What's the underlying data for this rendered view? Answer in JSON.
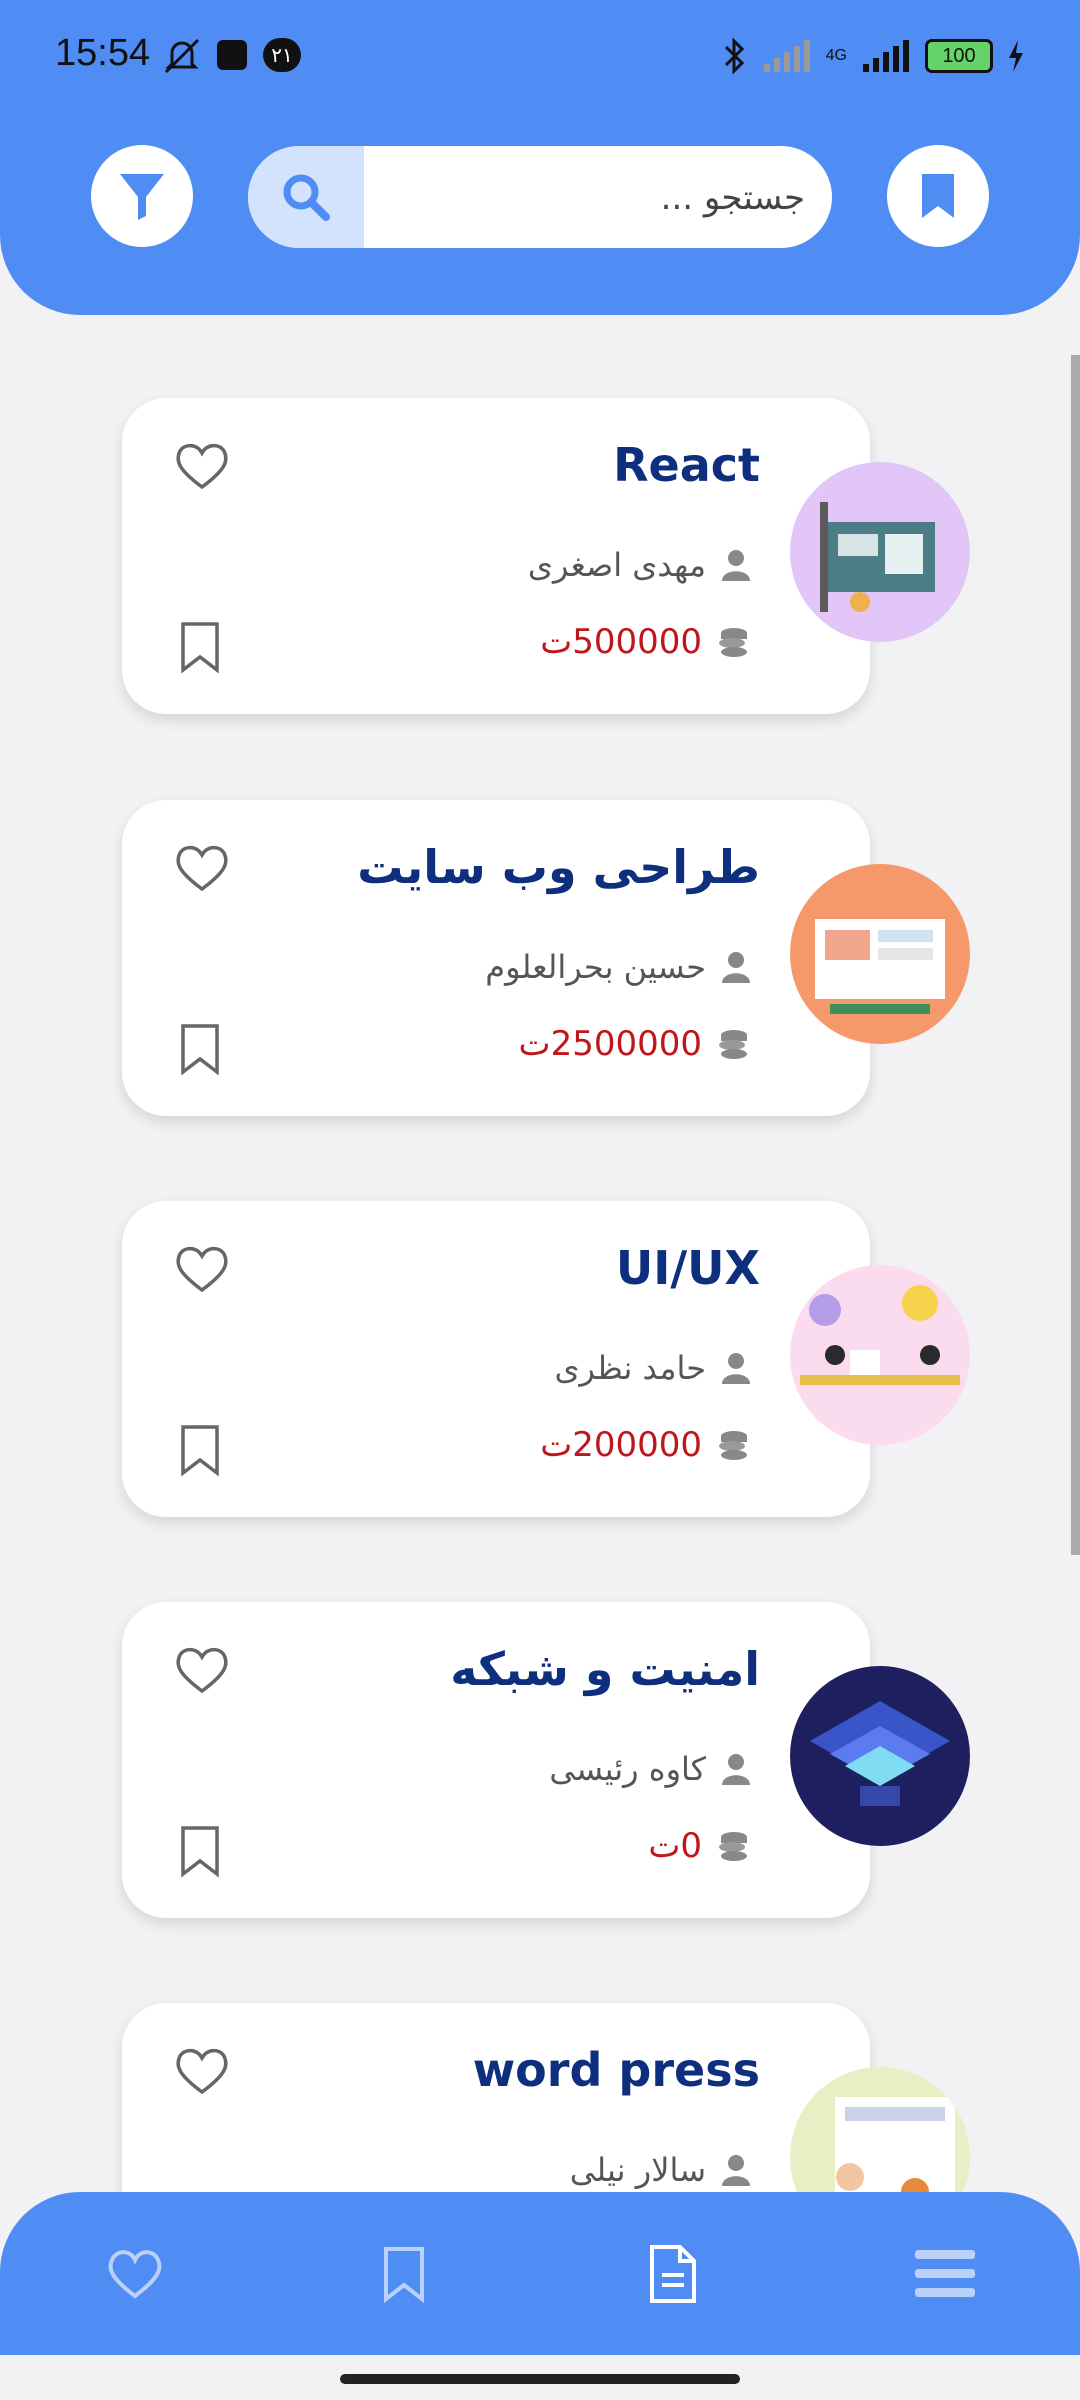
{
  "status_bar": {
    "time": "15:54",
    "notification_badge": "۲۱",
    "network": "4G",
    "battery": "100"
  },
  "header": {
    "search_placeholder": "جستجو ...",
    "icons": [
      "filter-icon",
      "search-icon",
      "bookmark-icon"
    ]
  },
  "courses": [
    {
      "title": "React",
      "author": "مهدی اصغری",
      "price": "500000",
      "currency": "ت",
      "thumb_bg": "#e2c6f7"
    },
    {
      "title": "طراحی وب سایت",
      "author": "حسین بحرالعلوم",
      "price": "2500000",
      "currency": "ت",
      "thumb_bg": "#f5996a"
    },
    {
      "title": "UI/UX",
      "author": "حامد نظری",
      "price": "200000",
      "currency": "ت",
      "thumb_bg": "#fbdcef"
    },
    {
      "title": "امنیت و شبکه",
      "author": "کاوه رئیسی",
      "price": "0",
      "currency": "ت",
      "thumb_bg": "#1d1f5e"
    },
    {
      "title": "word press",
      "author": "سالار نیلی",
      "price": "",
      "currency": "",
      "thumb_bg": "#e9efc4"
    }
  ],
  "bottom_nav": [
    "heart-icon",
    "bookmark-icon",
    "document-icon",
    "menu-icon"
  ],
  "colors": {
    "primary": "#4f8df5",
    "title": "#0e2f7d",
    "price": "#c0161b"
  }
}
